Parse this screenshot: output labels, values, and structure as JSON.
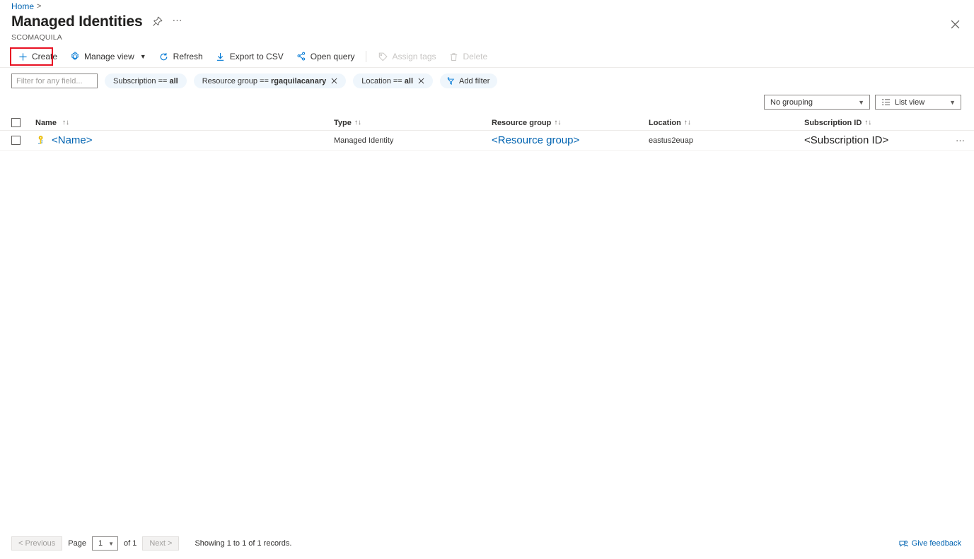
{
  "breadcrumb": {
    "home": "Home",
    "separator": ">"
  },
  "header": {
    "title": "Managed Identities",
    "subtitle": "SCOMAQUILA",
    "pin_icon": "pin-icon",
    "more_icon": "more-ellipsis-icon",
    "close_icon": "close-icon"
  },
  "toolbar": {
    "create_label": "Create",
    "manage_view_label": "Manage view",
    "refresh_label": "Refresh",
    "export_csv_label": "Export to CSV",
    "open_query_label": "Open query",
    "assign_tags_label": "Assign tags",
    "delete_label": "Delete",
    "highlight_color": "#e81123"
  },
  "filters": {
    "search_placeholder": "Filter for any field...",
    "search_value": "",
    "pills": [
      {
        "prefix": "Subscription ==",
        "value": "all",
        "removable": false
      },
      {
        "prefix": "Resource group ==",
        "value": "rgaquilacanary",
        "removable": true
      },
      {
        "prefix": "Location ==",
        "value": "all",
        "removable": true
      }
    ],
    "add_filter_label": "Add filter"
  },
  "view_controls": {
    "grouping_value": "No grouping",
    "listview_value": "List view"
  },
  "table": {
    "columns": [
      {
        "label": "Name",
        "sortable": true
      },
      {
        "label": "Type",
        "sortable": true
      },
      {
        "label": "Resource group",
        "sortable": true
      },
      {
        "label": "Location",
        "sortable": true
      },
      {
        "label": "Subscription ID",
        "sortable": true
      }
    ],
    "rows": [
      {
        "name": "<Name>",
        "type": "Managed Identity",
        "resource_group": "<Resource group>",
        "location": "eastus2euap",
        "subscription_id": "<Subscription ID>",
        "icon": "managed-identity-key-icon"
      }
    ]
  },
  "footer": {
    "previous_label": "< Previous",
    "page_label": "Page",
    "page_value": "1",
    "of_label": "of 1",
    "next_label": "Next >",
    "showing_label": "Showing 1 to 1 of 1 records.",
    "feedback_label": "Give feedback"
  },
  "colors": {
    "link": "#0063b1",
    "pill_bg": "#eff6fc",
    "accent_blue": "#0078d4",
    "highlight_red": "#e81123"
  }
}
